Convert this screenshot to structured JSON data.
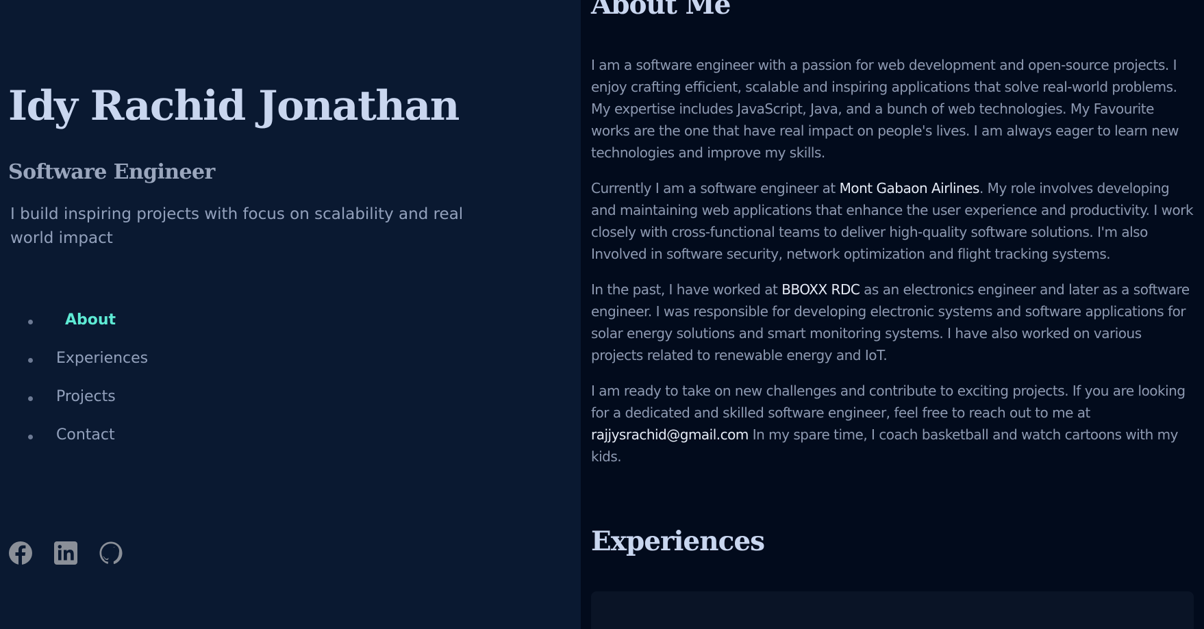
{
  "profile": {
    "name": "Idy Rachid Jonathan",
    "role": "Software Engineer",
    "tagline": "I build inspiring projects with focus on scalability and real world impact"
  },
  "nav": {
    "items": [
      {
        "label": "About",
        "active": true
      },
      {
        "label": "Experiences",
        "active": false
      },
      {
        "label": "Projects",
        "active": false
      },
      {
        "label": "Contact",
        "active": false
      }
    ]
  },
  "socials": [
    {
      "icon": "facebook-icon"
    },
    {
      "icon": "linkedin-icon"
    },
    {
      "icon": "github-icon"
    }
  ],
  "about": {
    "heading": "About Me",
    "p1": "I am a software engineer with a passion for web development and open-source projects. I enjoy crafting efficient, scalable and inspiring applications that solve real-world problems. My expertise includes JavaScript, Java, and a bunch of web technologies. My Favourite works are the one that have real impact on people's lives. I am always eager to learn new technologies and improve my skills.",
    "p2_before": "Currently I am a software engineer at ",
    "p2_link": "Mont Gabaon Airlines",
    "p2_after": ". My role involves developing and maintaining web applications that enhance the user experience and productivity. I work closely with cross-functional teams to deliver high-quality software solutions. I'm also Involved in software security, network optimization and flight tracking systems.",
    "p3_before": "In the past, I have worked at ",
    "p3_link": "BBOXX RDC",
    "p3_after": " as an electronics engineer and later as a software engineer. I was responsible for developing electronic systems and software applications for solar energy solutions and smart monitoring systems. I have also worked on various projects related to renewable energy and IoT.",
    "p4_before": "I am ready to take on new challenges and contribute to exciting projects. If you are looking for a dedicated and skilled software engineer, feel free to reach out to me at ",
    "p4_link": "rajjysrachid@gmail.com",
    "p4_after": " In my spare time, I coach basketball and watch cartoons with my kids."
  },
  "experiences": {
    "heading": "Experiences"
  },
  "colors": {
    "left_bg": "#0a1931",
    "right_bg": "#020b1c",
    "accent": "#5eead4",
    "heading": "#c9d6ef",
    "body_text": "#8e9ab2",
    "highlight": "#e6ecf7"
  }
}
